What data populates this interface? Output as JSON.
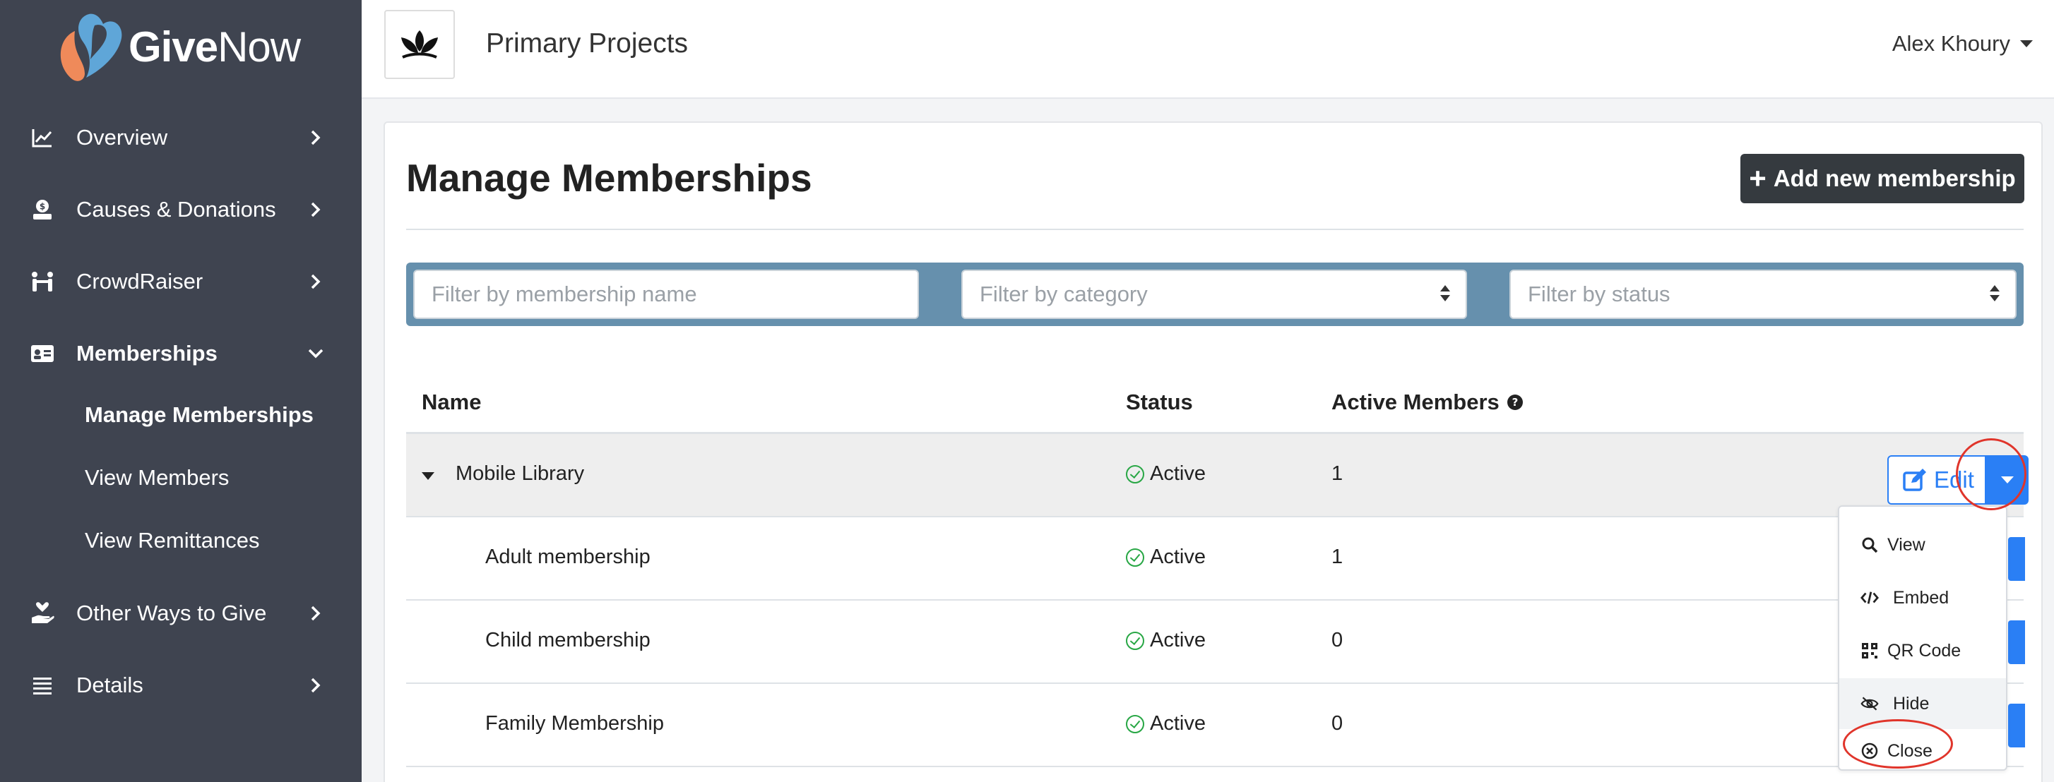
{
  "brand": {
    "name_bold": "Give",
    "name_light": "Now"
  },
  "sidebar": {
    "items": [
      {
        "label": "Overview",
        "icon": "chart-line-icon"
      },
      {
        "label": "Causes & Donations",
        "icon": "donation-icon"
      },
      {
        "label": "CrowdRaiser",
        "icon": "people-icon"
      },
      {
        "label": "Memberships",
        "icon": "id-card-icon",
        "expanded": true
      },
      {
        "label": "Other Ways to Give",
        "icon": "hand-heart-icon"
      },
      {
        "label": "Details",
        "icon": "list-icon"
      }
    ],
    "sub_items": [
      {
        "label": "Manage Memberships",
        "active": true
      },
      {
        "label": "View Members"
      },
      {
        "label": "View Remittances"
      }
    ]
  },
  "topbar": {
    "org_name": "Primary Projects",
    "user_name": "Alex Khoury"
  },
  "page": {
    "title": "Manage Memberships",
    "add_button": "Add new membership"
  },
  "filters": {
    "name_placeholder": "Filter by membership name",
    "category_placeholder": "Filter by category",
    "status_placeholder": "Filter by status"
  },
  "table": {
    "headers": {
      "name": "Name",
      "status": "Status",
      "active_members": "Active Members"
    },
    "rows": [
      {
        "name": "Mobile Library",
        "status": "Active",
        "active_members": "1",
        "parent": true
      },
      {
        "name": "Adult membership",
        "status": "Active",
        "active_members": "1"
      },
      {
        "name": "Child membership",
        "status": "Active",
        "active_members": "0"
      },
      {
        "name": "Family Membership",
        "status": "Active",
        "active_members": "0"
      }
    ],
    "edit_label": "Edit"
  },
  "dropdown": {
    "items": [
      {
        "label": "View",
        "icon": "search-icon"
      },
      {
        "label": "Embed",
        "icon": "code-icon"
      },
      {
        "label": "QR Code",
        "icon": "qr-code-icon"
      },
      {
        "label": "Hide",
        "icon": "eye-slash-icon"
      },
      {
        "label": "Close",
        "icon": "close-circle-icon"
      }
    ]
  },
  "colors": {
    "sidebar": "#3f4450",
    "accent": "#2a7ff5",
    "filter_bar": "#6690ad",
    "highlight": "#e0352b",
    "success": "#28a745"
  }
}
